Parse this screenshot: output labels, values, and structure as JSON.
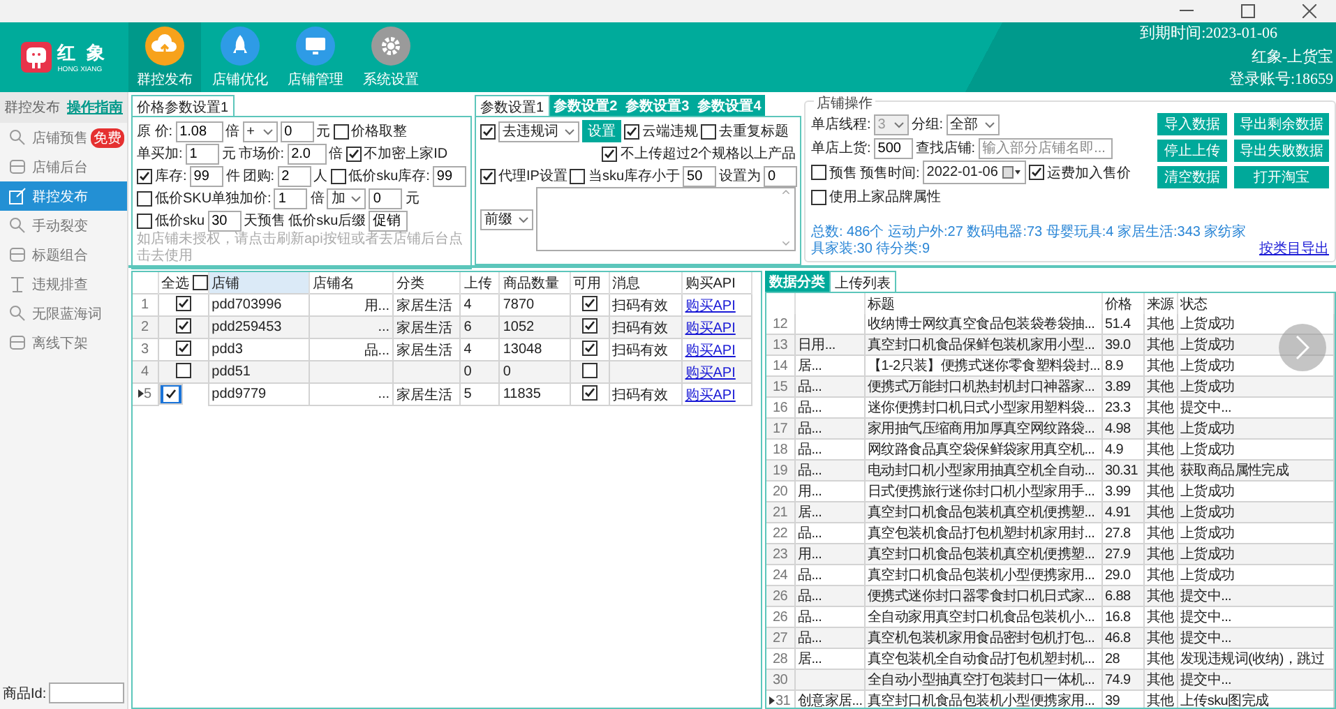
{
  "header": {
    "logo": {
      "name": "红 象",
      "subtitle": "HONG XIANG"
    },
    "nav": [
      {
        "label": "群控发布",
        "selected": true,
        "color": "#f7a21b"
      },
      {
        "label": "店铺优化",
        "selected": false,
        "color": "#2e9be6"
      },
      {
        "label": "店铺管理",
        "selected": false,
        "color": "#2e9be6"
      },
      {
        "label": "系统设置",
        "selected": false,
        "color": "#9a9a9a"
      }
    ],
    "expiry": "到期时间:2023-01-06",
    "product": "红象-上货宝",
    "account": "登录账号:18659"
  },
  "sidebar": {
    "title": "群控发布",
    "guide": "操作指南",
    "items": [
      {
        "label": "店铺预售",
        "selected": false,
        "badge": "免费"
      },
      {
        "label": "店铺后台",
        "selected": false
      },
      {
        "label": "群控发布",
        "selected": true
      },
      {
        "label": "手动裂变",
        "selected": false
      },
      {
        "label": "标题组合",
        "selected": false
      },
      {
        "label": "违规排查",
        "selected": false
      },
      {
        "label": "无限蓝海词",
        "selected": false
      },
      {
        "label": "离线下架",
        "selected": false
      }
    ],
    "product_id_label": "商品Id:"
  },
  "price_panel": {
    "tabs": [
      {
        "label": "价格参数设置1",
        "selected": true
      }
    ],
    "rows": [
      {
        "items": [
          {
            "kind": "label",
            "text": "原  价:"
          },
          {
            "kind": "input",
            "value": "1.08"
          },
          {
            "kind": "label",
            "text": "倍"
          },
          {
            "kind": "select",
            "value": "+"
          },
          {
            "kind": "input",
            "value": "0"
          },
          {
            "kind": "label",
            "text": "元"
          },
          {
            "kind": "checkbox",
            "label": "价格取整",
            "checked": false
          }
        ]
      },
      {
        "items": [
          {
            "kind": "label",
            "text": "单买加:"
          },
          {
            "kind": "input",
            "value": "1"
          },
          {
            "kind": "label",
            "text": "元"
          },
          {
            "kind": "label",
            "text": "市场价:"
          },
          {
            "kind": "input",
            "value": "2.0"
          },
          {
            "kind": "label",
            "text": "倍"
          },
          {
            "kind": "checkbox",
            "label": "不加密上家ID",
            "checked": true
          }
        ]
      },
      {
        "items": [
          {
            "kind": "checkbox",
            "label": "库存:",
            "checked": true
          },
          {
            "kind": "input",
            "value": "99"
          },
          {
            "kind": "label",
            "text": "件"
          },
          {
            "kind": "label",
            "text": "团购:"
          },
          {
            "kind": "input",
            "value": "2"
          },
          {
            "kind": "label",
            "text": "人"
          },
          {
            "kind": "checkbox",
            "label": "低价sku库存:",
            "checked": false
          },
          {
            "kind": "input",
            "value": "99"
          }
        ]
      },
      {
        "items": [
          {
            "kind": "checkbox",
            "label": "低价SKU单独加价:",
            "checked": false
          },
          {
            "kind": "input",
            "value": "1"
          },
          {
            "kind": "label",
            "text": "倍"
          },
          {
            "kind": "select",
            "value": "加"
          },
          {
            "kind": "input",
            "value": "0"
          },
          {
            "kind": "label",
            "text": "元"
          }
        ]
      },
      {
        "items": [
          {
            "kind": "checkbox",
            "label": "低价sku",
            "checked": false
          },
          {
            "kind": "input",
            "value": "30"
          },
          {
            "kind": "label",
            "text": "天预售"
          },
          {
            "kind": "label",
            "text": "低价sku后缀"
          },
          {
            "kind": "input",
            "value": "促销"
          }
        ]
      }
    ],
    "note": "如店铺未授权，请点击刷新api按钮或者去店铺后台点击去使用"
  },
  "param_panel": {
    "tabs": [
      {
        "label": "参数设置1",
        "selected": true
      },
      {
        "label": "参数设置2",
        "selected": false
      },
      {
        "label": "参数设置3",
        "selected": false
      },
      {
        "label": "参数设置4",
        "selected": false
      }
    ],
    "rows": [
      {
        "items": [
          {
            "kind": "checkbox",
            "checked": true
          },
          {
            "kind": "select",
            "value": "去违规词"
          },
          {
            "kind": "button",
            "label": "设置"
          },
          {
            "kind": "checkbox",
            "label": "云端违规",
            "checked": true
          },
          {
            "kind": "checkbox",
            "label": "去重复标题",
            "checked": false
          }
        ]
      },
      {
        "items": [
          {
            "kind": "checkbox",
            "label": "不上传超过2个规格以上产品",
            "checked": true
          }
        ]
      },
      {
        "items": [
          {
            "kind": "checkbox",
            "label": "代理IP设置",
            "checked": true
          },
          {
            "kind": "checkbox",
            "label": "当sku库存小于",
            "checked": false
          },
          {
            "kind": "input",
            "value": "50"
          },
          {
            "kind": "label",
            "text": "设置为"
          },
          {
            "kind": "input",
            "value": "0"
          }
        ]
      },
      {
        "items": [
          {
            "kind": "select",
            "value": "前缀"
          },
          {
            "kind": "textarea"
          }
        ]
      }
    ]
  },
  "store_panel": {
    "title": "店铺操作",
    "rows": [
      {
        "items": [
          {
            "kind": "label",
            "text": "单店线程:"
          },
          {
            "kind": "select",
            "value": "3",
            "disabled": true
          },
          {
            "kind": "label",
            "text": "分组:"
          },
          {
            "kind": "select",
            "value": "全部",
            "disabled": false
          }
        ]
      },
      {
        "items": [
          {
            "kind": "label",
            "text": "单店上货:"
          },
          {
            "kind": "input",
            "value": "500"
          },
          {
            "kind": "label",
            "text": "查找店铺:"
          },
          {
            "kind": "input",
            "placeholder": "输入部分店铺名即..."
          }
        ]
      },
      {
        "items": [
          {
            "kind": "checkbox",
            "label": "预售",
            "checked": false
          },
          {
            "kind": "label",
            "text": "预售时间:"
          },
          {
            "kind": "date",
            "value": "2022-01-06"
          },
          {
            "kind": "checkbox",
            "label": "运费加入售价",
            "checked": true
          }
        ]
      },
      {
        "items": [
          {
            "kind": "checkbox",
            "label": "使用上家品牌属性",
            "checked": false
          }
        ]
      }
    ],
    "buttons": [
      "导入数据",
      "导出剩余数据",
      "停止上传",
      "导出失败数据",
      "清空数据",
      "打开淘宝"
    ],
    "summary": "总数: 486个   运动户外:27 数码电器:73 母婴玩具:4 家居生活:343 家纺家具家装:30 待分类:9",
    "export_link": "按类目导出"
  },
  "store_table": {
    "columns": [
      "全选",
      "店铺",
      "店铺名",
      "分类",
      "上传",
      "商品数量",
      "可用",
      "消息",
      "购买API"
    ],
    "select_all": false,
    "rows": [
      {
        "index": "1",
        "checked": true,
        "store": "pdd703996",
        "name": "用...",
        "category": "家居生活",
        "uploads": "4",
        "count": "7870",
        "available": true,
        "message": "扫码有效",
        "api": "购买API",
        "selected": false,
        "current": false
      },
      {
        "index": "2",
        "checked": true,
        "store": "pdd259453",
        "name": "...",
        "category": "家居生活",
        "uploads": "6",
        "count": "1052",
        "available": true,
        "message": "扫码有效",
        "api": "购买API",
        "selected": false,
        "current": false
      },
      {
        "index": "3",
        "checked": true,
        "store": "pdd3",
        "name": "品...",
        "category": "家居生活",
        "uploads": "4",
        "count": "13048",
        "available": true,
        "message": "扫码有效",
        "api": "购买API",
        "selected": false,
        "current": false
      },
      {
        "index": "4",
        "checked": false,
        "store": "pdd51",
        "uploads": "0",
        "count": "0",
        "available": false,
        "api": "购买API",
        "selected": false,
        "current": false
      },
      {
        "index": "5",
        "checked": true,
        "store": "pdd9779",
        "name": "...",
        "category": "家居生活",
        "uploads": "5",
        "count": "11835",
        "available": true,
        "message": "扫码有效",
        "api": "购买API",
        "selected": true,
        "current": true
      }
    ]
  },
  "upload_panel": {
    "tabs": [
      {
        "label": "数据分类",
        "selected": false
      },
      {
        "label": "上传列表",
        "selected": true
      }
    ],
    "columns": [
      "标题",
      "价格",
      "来源",
      "状态"
    ],
    "rows": [
      {
        "index": "12",
        "title": "收纳博士网纹真空食品包装袋卷袋抽...",
        "price": "51.4",
        "source": "其他",
        "status": "上货成功",
        "current": false
      },
      {
        "index": "13",
        "shop": "日用...",
        "title": "真空封口机食品保鲜包装机家用小型...",
        "price": "39.0",
        "source": "其他",
        "status": "上货成功",
        "current": false
      },
      {
        "index": "14",
        "shop": "居...",
        "title": "【1-2只装】便携式迷你零食塑料袋封...",
        "price": "8.9",
        "source": "其他",
        "status": "上货成功",
        "current": false
      },
      {
        "index": "15",
        "shop": "品...",
        "title": "便携式万能封口机热封机封口神器家...",
        "price": "3.89",
        "source": "其他",
        "status": "上货成功",
        "current": false
      },
      {
        "index": "16",
        "shop": "品...",
        "title": "迷你便携封口机日式小型家用塑料袋...",
        "price": "23.3",
        "source": "其他",
        "status": "提交中...",
        "current": false
      },
      {
        "index": "17",
        "shop": "品...",
        "title": "家用抽气压缩商用加厚真空网纹路袋...",
        "price": "4.98",
        "source": "其他",
        "status": "上货成功",
        "current": false
      },
      {
        "index": "18",
        "shop": "品...",
        "title": "网纹路食品真空袋保鲜袋家用真空机...",
        "price": "4.9",
        "source": "其他",
        "status": "上货成功",
        "current": false
      },
      {
        "index": "19",
        "shop": "品...",
        "title": "电动封口机小型家用抽真空机全自动...",
        "price": "30.31",
        "source": "其他",
        "status": "获取商品属性完成",
        "current": false
      },
      {
        "index": "20",
        "shop": "用...",
        "title": "日式便携旅行迷你封口机小型家用手...",
        "price": "3.99",
        "source": "其他",
        "status": "上货成功",
        "current": false
      },
      {
        "index": "21",
        "shop": "居...",
        "title": "真空封口机食品包装机真空机便携塑...",
        "price": "4.91",
        "source": "其他",
        "status": "上货成功",
        "current": false
      },
      {
        "index": "22",
        "shop": "品...",
        "title": "真空包装机食品打包机塑封机家用封...",
        "price": "27.8",
        "source": "其他",
        "status": "上货成功",
        "current": false
      },
      {
        "index": "23",
        "shop": "用...",
        "title": "真空封口机食品包装机真空机便携塑...",
        "price": "27.9",
        "source": "其他",
        "status": "上货成功",
        "current": false
      },
      {
        "index": "24",
        "shop": "品...",
        "title": "真空封口机食品包装机小型便携家用...",
        "price": "29.0",
        "source": "其他",
        "status": "上货成功",
        "current": false
      },
      {
        "index": "26",
        "shop": "品...",
        "title": "便携式迷你封口器零食封口机日式家...",
        "price": "6.88",
        "source": "其他",
        "status": "提交中...",
        "current": false
      },
      {
        "index": "26",
        "shop": "品...",
        "title": "全自动家用真空封口机食品包装机小...",
        "price": "16.8",
        "source": "其他",
        "status": "提交中...",
        "current": false
      },
      {
        "index": "27",
        "shop": "品...",
        "title": "真空机包装机家用食品密封包机打包...",
        "price": "46.8",
        "source": "其他",
        "status": "提交中...",
        "current": false
      },
      {
        "index": "28",
        "shop": "居...",
        "title": "真空包装机全自动食品打包机塑封机...",
        "price": "28",
        "source": "其他",
        "status": "发现违规词(收纳)，跳过",
        "current": false
      },
      {
        "index": "30",
        "title": "全自动小型抽真空打包装封口一体机...",
        "price": "74.9",
        "source": "其他",
        "status": "提交中...",
        "current": false
      },
      {
        "index": "31",
        "shop": "创意家居...",
        "title": "真空封口机食品包装机小型便携家用...",
        "price": "39",
        "source": "其他",
        "status": "上传sku图完成",
        "current": true
      }
    ]
  }
}
